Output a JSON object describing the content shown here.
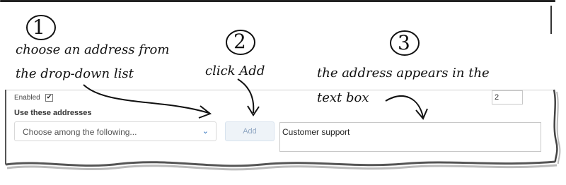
{
  "steps": [
    {
      "number": "1",
      "line1": "choose an address from",
      "line2": "the drop-down list"
    },
    {
      "number": "2",
      "line1": "click Add"
    },
    {
      "number": "3",
      "line1": "the address appears in the",
      "line2": "text box"
    }
  ],
  "form": {
    "enabled_label": "Enabled",
    "enabled_checked": "✔",
    "section_label": "Use these addresses",
    "select_placeholder": "Choose among the following...",
    "add_label": "Add",
    "textbox_value": "Customer support",
    "number_value": "2"
  },
  "icons": {
    "dropdown": "chevron-down-icon",
    "checkbox": "checkmark-icon"
  }
}
